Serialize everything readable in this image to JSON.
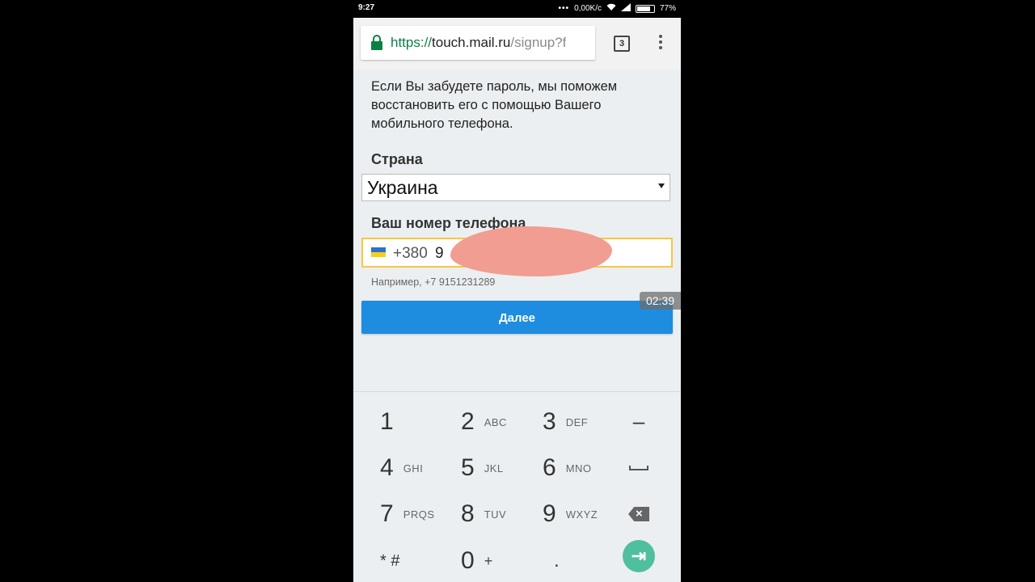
{
  "status_bar": {
    "time": "9:27",
    "net_speed": "0,00K/c",
    "battery": "77%"
  },
  "browser": {
    "url_scheme": "https://",
    "url_host": "touch.mail.ru",
    "url_path": "/signup?f",
    "tab_count": "3"
  },
  "form": {
    "info_text": "Если Вы забудете пароль, мы поможем восстановить его с помощью Вашего мобильного телефона.",
    "country_label": "Страна",
    "country_value": "Украина",
    "phone_label": "Ваш номер телефона",
    "phone_prefix": "+380",
    "phone_value_visible": "9",
    "phone_hint": "Например, +7 9151231289",
    "next_button": "Далее"
  },
  "overlay": {
    "timer": "02:39"
  },
  "colors": {
    "accent_blue": "#1e8de0",
    "focus_yellow": "#f6c83f",
    "lock_green": "#0b8043",
    "go_teal": "#4fbfa0"
  },
  "keypad": {
    "keys": [
      {
        "num": "1",
        "letters": ""
      },
      {
        "num": "2",
        "letters": "ABC"
      },
      {
        "num": "3",
        "letters": "DEF"
      },
      {
        "num": "4",
        "letters": "GHI"
      },
      {
        "num": "5",
        "letters": "JKL"
      },
      {
        "num": "6",
        "letters": "MNO"
      },
      {
        "num": "7",
        "letters": "PRQS"
      },
      {
        "num": "8",
        "letters": "TUV"
      },
      {
        "num": "9",
        "letters": "WXYZ"
      },
      {
        "num": "* #",
        "letters": ""
      },
      {
        "num": "0",
        "letters": "+"
      },
      {
        "num": ".",
        "letters": ""
      }
    ],
    "minus": "–",
    "special_icons": [
      "space-icon",
      "backspace-icon",
      "next-field-icon"
    ]
  }
}
